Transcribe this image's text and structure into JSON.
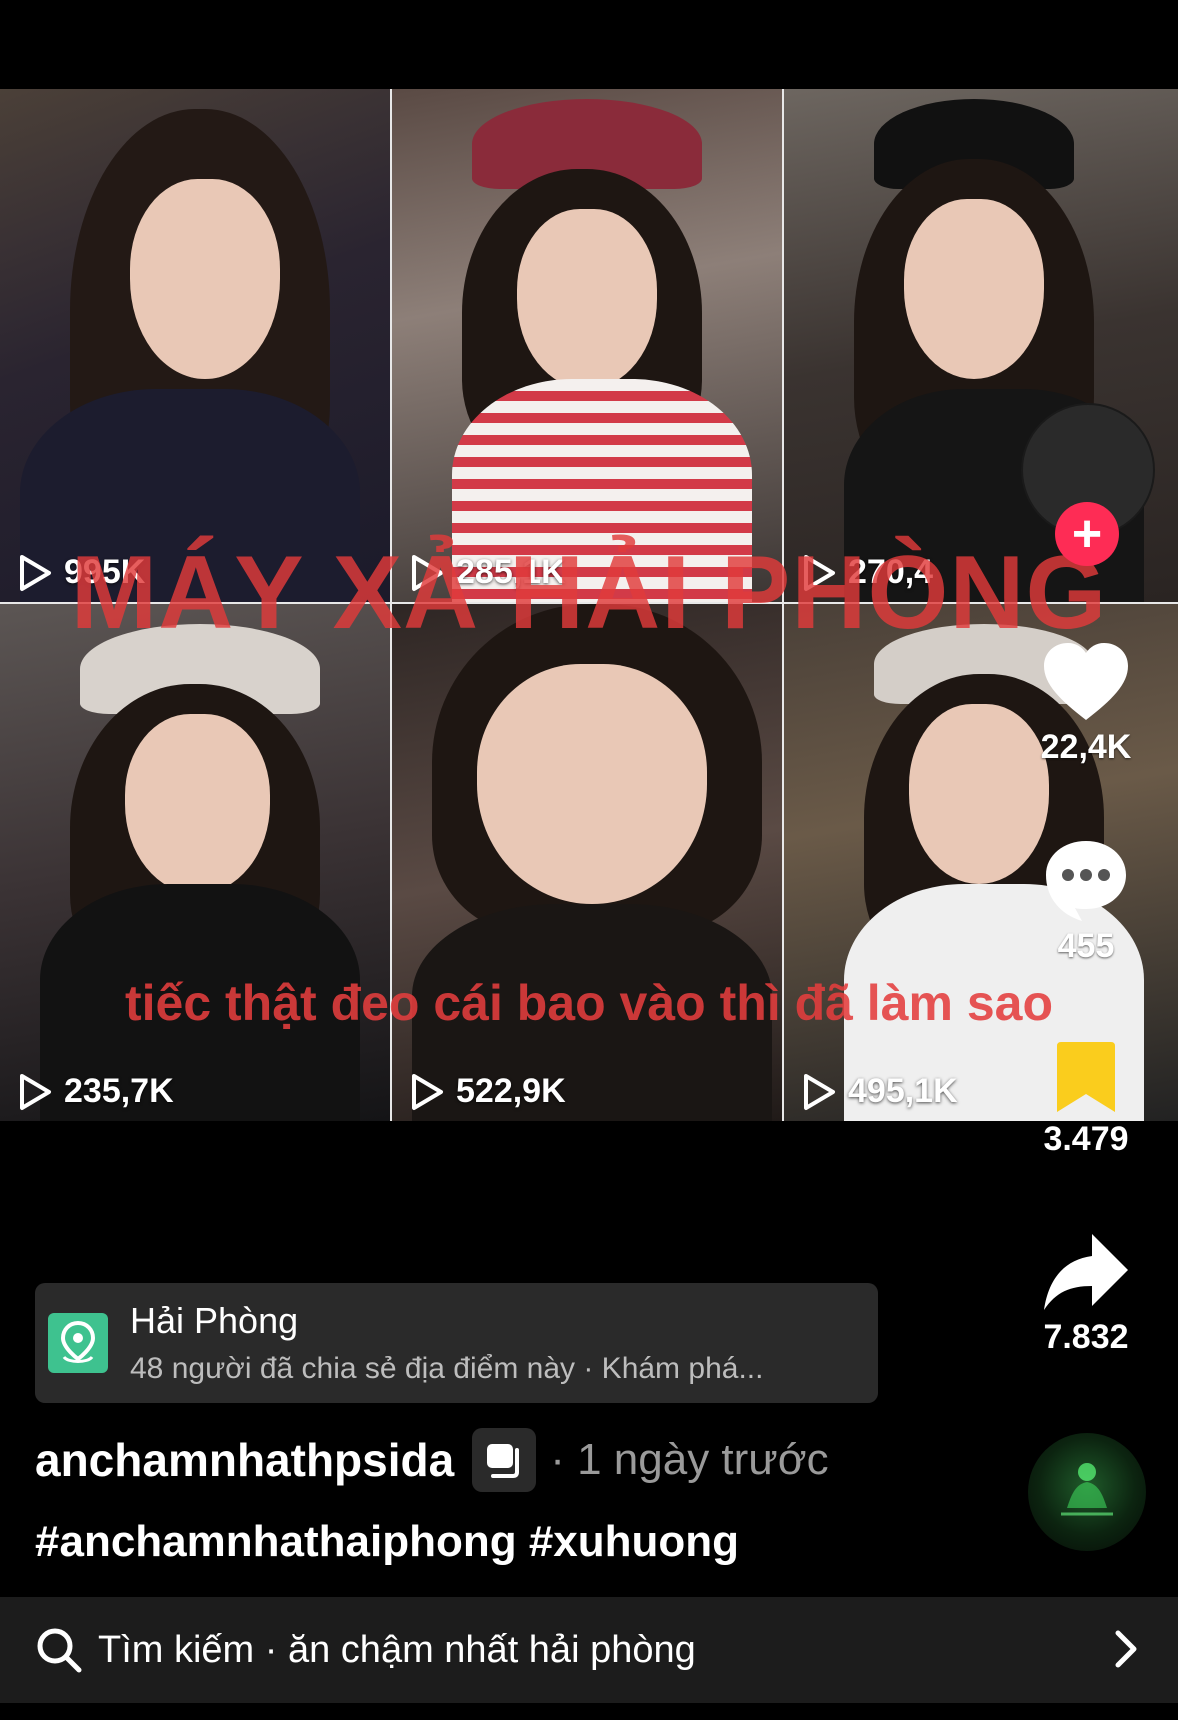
{
  "video": {
    "overlay_title": "MÁY XẢ HẢI PHÒNG",
    "overlay_subtitle": "tiếc thật đeo cái bao vào thì đã làm sao",
    "tiles": [
      {
        "views": "995K"
      },
      {
        "views": "285,1K"
      },
      {
        "views": "270,4"
      },
      {
        "views": "235,7K"
      },
      {
        "views": "522,9K"
      },
      {
        "views": "495,1K"
      }
    ]
  },
  "actions": {
    "likes": "22,4K",
    "comments": "455",
    "saves": "3.479",
    "shares": "7.832",
    "follow_symbol": "+"
  },
  "location": {
    "title": "Hải Phòng",
    "subtitle": "48 người đã chia sẻ địa điểm này · Khám phá..."
  },
  "post": {
    "author": "anchamnhathpsida",
    "time": "· 1 ngày trước",
    "hashtags": "#anchamnhathaiphong #xuhuong"
  },
  "search": {
    "text": "Tìm kiếm · ăn chậm nhất hải phòng"
  },
  "colors": {
    "like": "#ffffff",
    "save": "#facd1d",
    "follow": "#fe2c55",
    "location_icon": "#3ec28f",
    "overlay_text": "#e03a3a"
  }
}
